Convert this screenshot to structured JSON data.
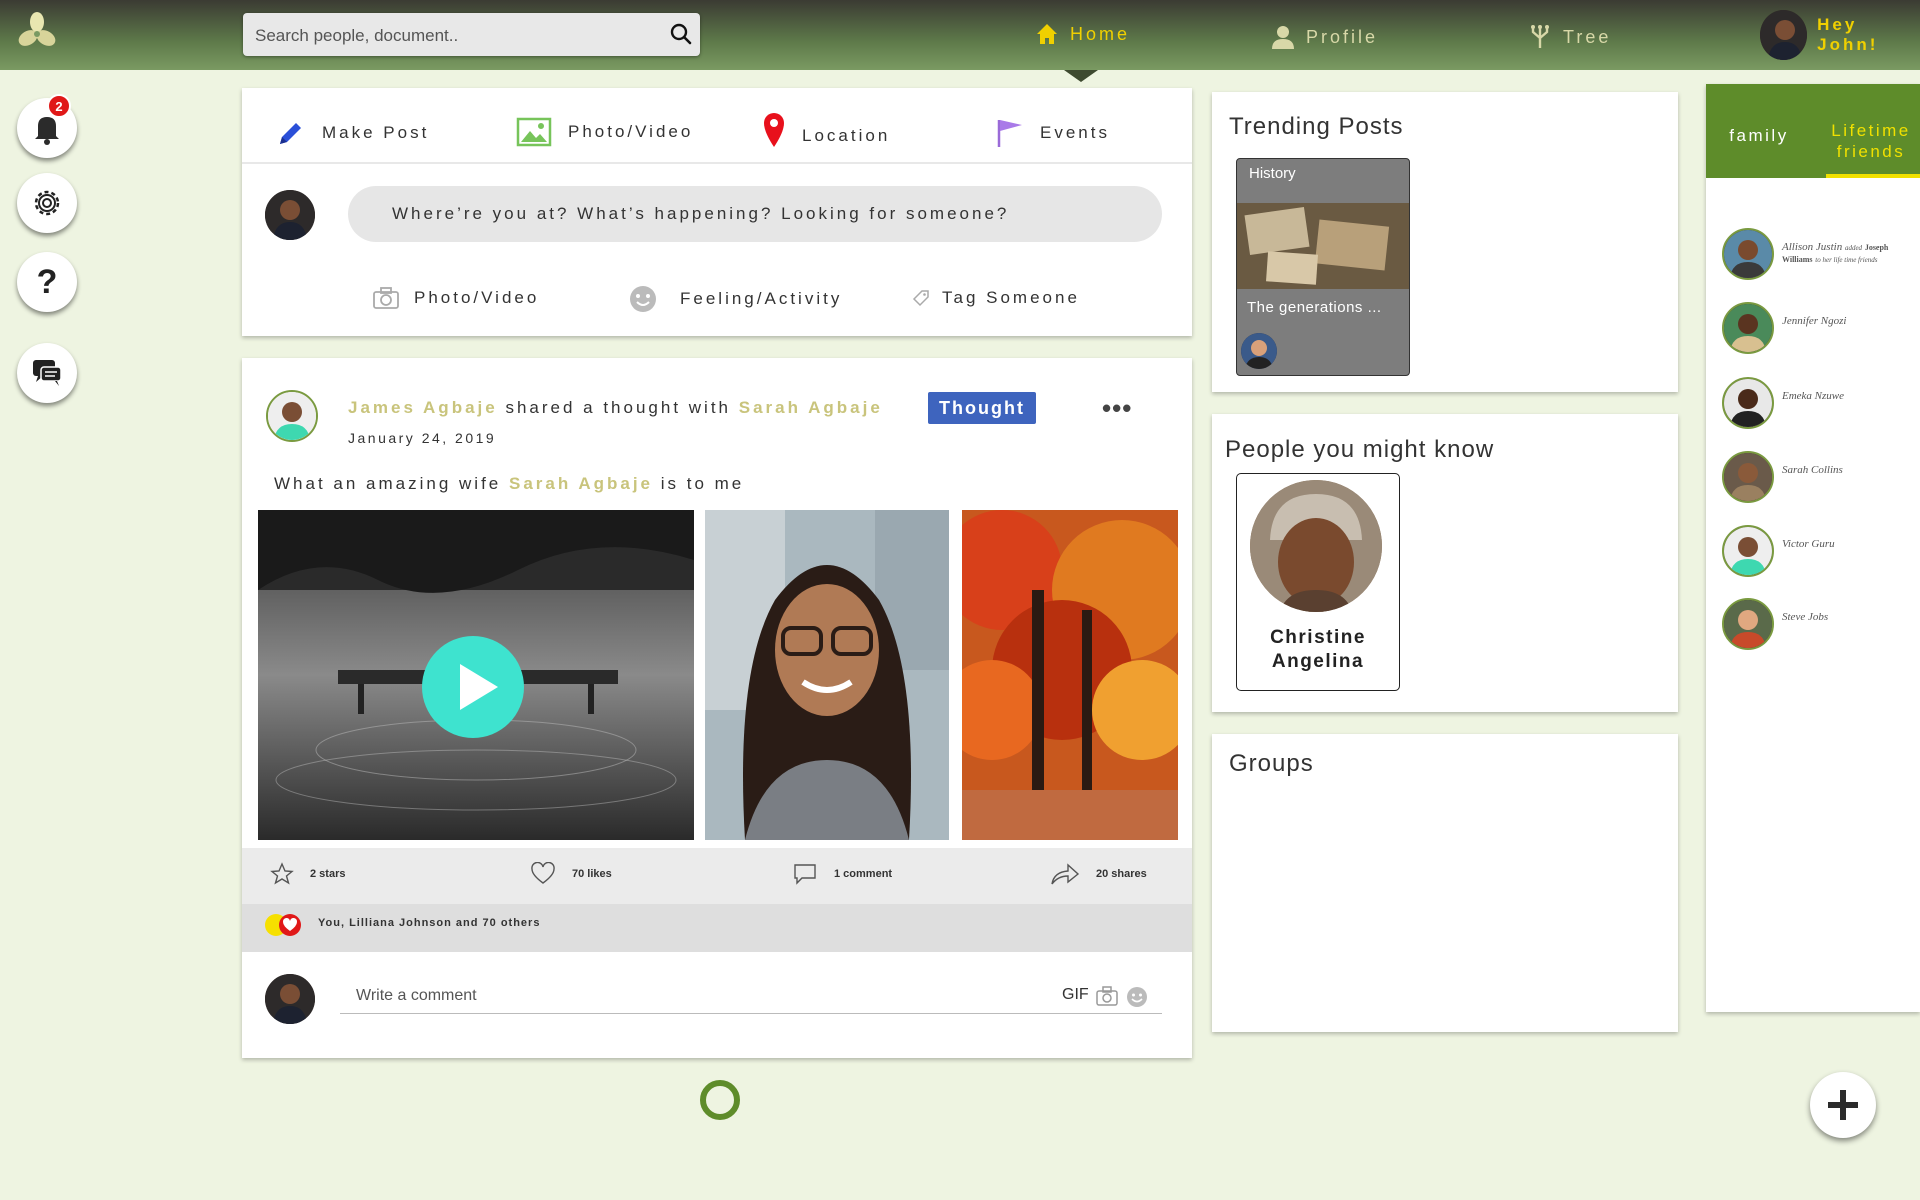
{
  "search": {
    "placeholder": "Search people, document.."
  },
  "nav": {
    "home": "Home",
    "profile": "Profile",
    "tree": "Tree",
    "greeting": "Hey John!"
  },
  "notifications": {
    "count": "2"
  },
  "composer": {
    "tabs": {
      "make_post": "Make Post",
      "photo_video": "Photo/Video",
      "location": "Location",
      "events": "Events"
    },
    "placeholder": "Where’re you at? What’s happening? Looking for someone?",
    "actions": {
      "photo_video": "Photo/Video",
      "feeling": "Feeling/Activity",
      "tag": "Tag Someone"
    }
  },
  "post": {
    "author": "James Agbaje",
    "verb": "shared a thought with",
    "recipient": "Sarah Agbaje",
    "tag": "Thought",
    "date": "January 24, 2019",
    "text_before": "What an amazing wife",
    "text_mention": "Sarah Agbaje",
    "text_after": "is to me",
    "stats": {
      "stars": "2 stars",
      "likes": "70 likes",
      "comments": "1 comment",
      "shares": "20 shares"
    },
    "reactions_text": "You, Lilliana Johnson and 70 others",
    "comment_placeholder": "Write a comment",
    "gif_label": "GIF"
  },
  "trending": {
    "title": "Trending Posts",
    "card": {
      "category": "History",
      "caption": "The generations ..."
    }
  },
  "people": {
    "title": "People you might know",
    "person_first": "Christine",
    "person_last": "Angelina"
  },
  "groups": {
    "title": "Groups"
  },
  "friends_panel": {
    "tab_family": "family",
    "tab_lifetime_line1": "Lifetime",
    "tab_lifetime_line2": "friends",
    "items": [
      {
        "name": "Allison Justin",
        "note_pre": "added",
        "note_name": "Joseph Williams",
        "note_post": "to her life time friends"
      },
      {
        "name": "Jennifer Ngozi"
      },
      {
        "name": "Emeka Nzuwe"
      },
      {
        "name": "Sarah Collins"
      },
      {
        "name": "Victor Guru"
      },
      {
        "name": "Steve Jobs"
      }
    ]
  },
  "colors": {
    "accent": "#c9c47c",
    "header_green": "#6b8c4a",
    "active_tab": "#f0d000",
    "thought_tag": "#3e64be",
    "play": "#3ee3cf"
  }
}
